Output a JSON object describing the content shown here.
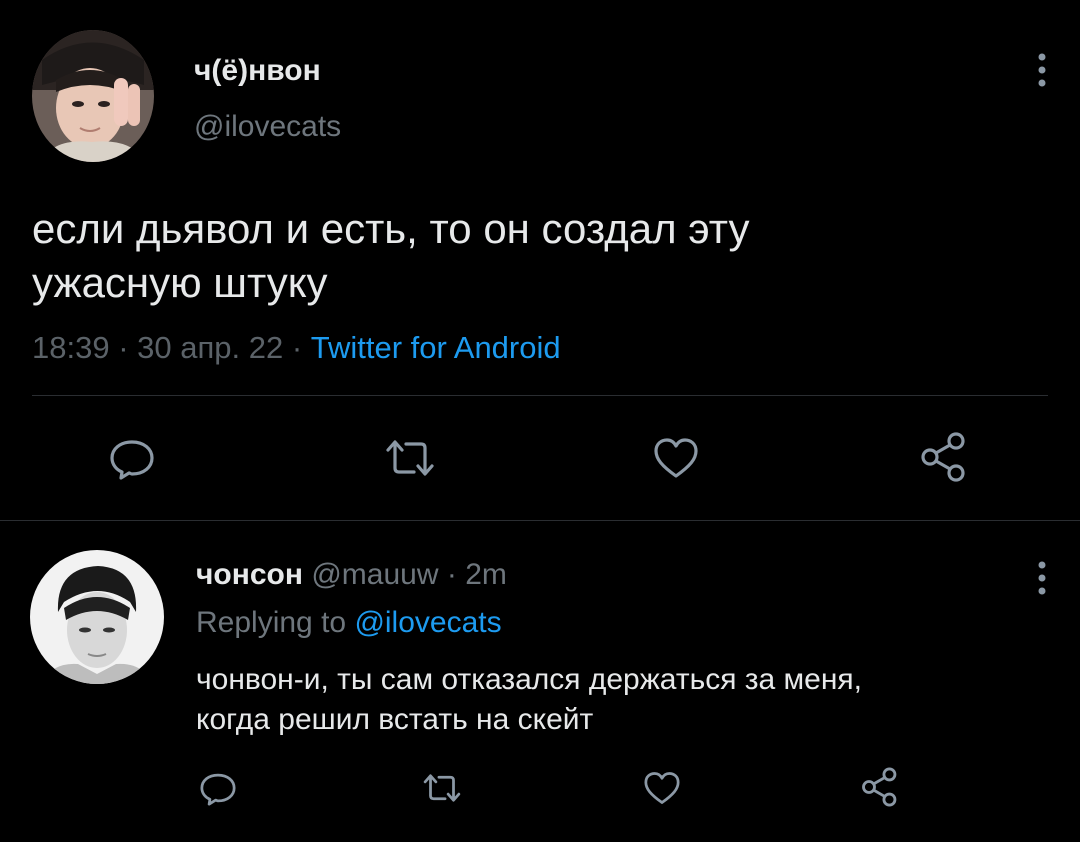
{
  "main_tweet": {
    "author_name": "ч(ё)нвон",
    "author_handle": "@ilovecats",
    "text": "если дьявол и есть, то он создал эту\nужасную штуку",
    "time": "18:39",
    "separator": " · ",
    "date": "30 апр. 22",
    "source": "Twitter for Android"
  },
  "reply_tweet": {
    "author_name": "чонсон",
    "author_handle": "@mauuw",
    "separator": " · ",
    "time": "2m",
    "replying_label": "Replying to ",
    "replying_to": "@ilovecats",
    "text": "чонвон-и, ты сам отказался держаться за меня,\nкогда решил встать на скейт"
  },
  "icons": {
    "reply": "reply-icon",
    "retweet": "retweet-icon",
    "like": "heart-icon",
    "share": "share-icon",
    "more": "more-vertical-icon"
  },
  "colors": {
    "background": "#000000",
    "text": "#e7e9ea",
    "secondary_text": "#6e767d",
    "link": "#1d9bf0",
    "icon": "#8b98a5",
    "divider": "#2a2d31"
  }
}
